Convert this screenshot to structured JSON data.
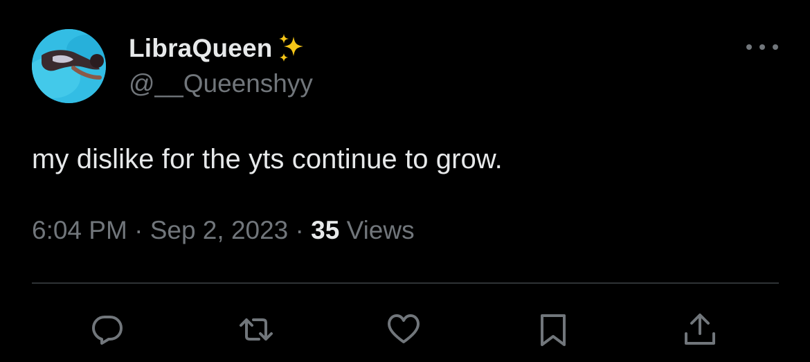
{
  "user": {
    "display_name": "LibraQueen",
    "handle": "@__Queenshyy",
    "badge_emoji": "sparkles-icon",
    "avatar": "avatar-photo"
  },
  "tweet": {
    "text": "my dislike for the yts continue to grow."
  },
  "meta": {
    "time": "6:04 PM",
    "separator": " · ",
    "date": "Sep 2, 2023",
    "views_count": "35",
    "views_label": " Views"
  },
  "actions": [
    {
      "icon": "reply-icon"
    },
    {
      "icon": "retweet-icon"
    },
    {
      "icon": "like-icon"
    },
    {
      "icon": "bookmark-icon"
    },
    {
      "icon": "share-icon"
    }
  ],
  "colors": {
    "background": "#000000",
    "primary_text": "#e7e9ea",
    "secondary_text": "#71767b",
    "divider": "#2f3336",
    "sparkle": "#f5c518"
  }
}
